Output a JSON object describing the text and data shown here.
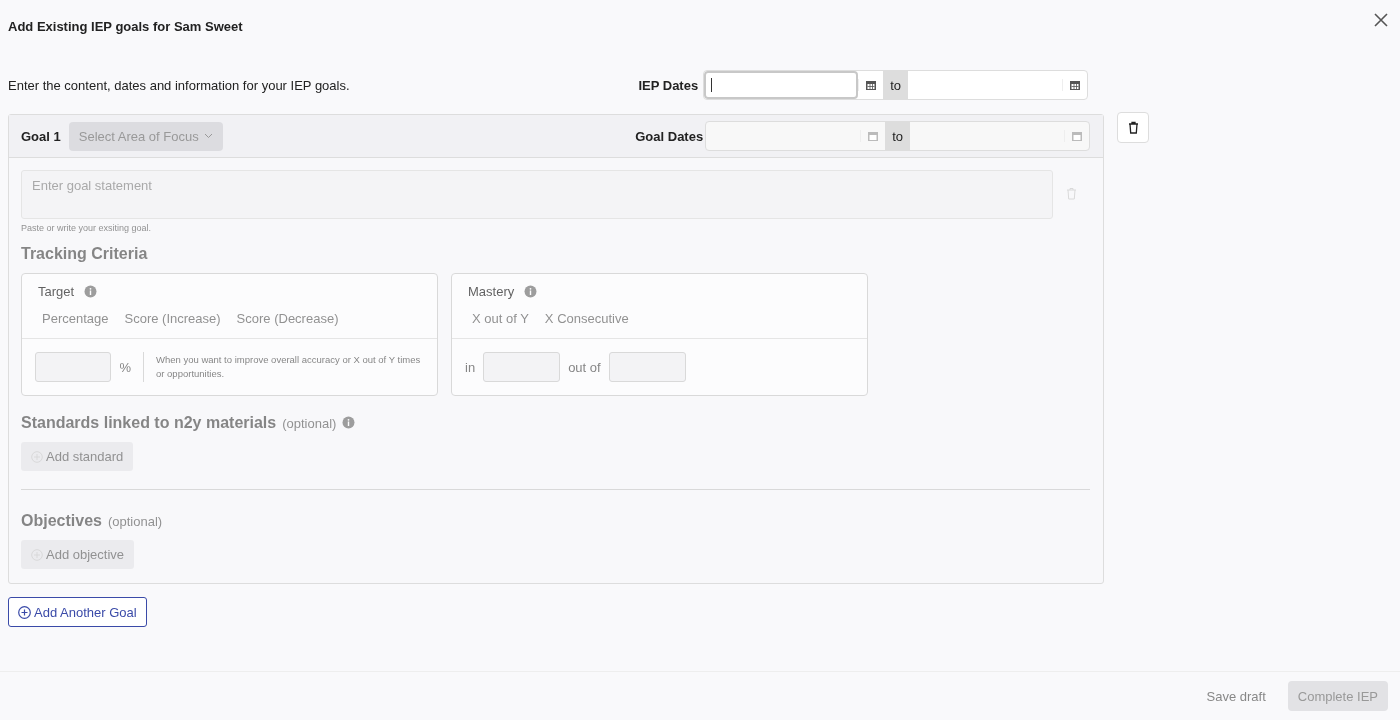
{
  "dialog": {
    "title": "Add Existing IEP goals for Sam Sweet"
  },
  "intro": "Enter the content, dates and information for your IEP goals.",
  "iep_dates": {
    "label": "IEP Dates",
    "separator": "to",
    "focused": true
  },
  "goals": [
    {
      "label": "Goal 1",
      "disabled": true,
      "area_of_focus": {
        "placeholder": "Select Area of Focus"
      },
      "dates": {
        "label": "Goal Dates",
        "separator": "to"
      },
      "statement": {
        "placeholder": "Enter goal statement",
        "hint": "Paste or write your exsiting goal."
      },
      "tracking": {
        "title": "Tracking Criteria",
        "target": {
          "title": "Target",
          "options": [
            {
              "label": "Percentage",
              "selected": false
            },
            {
              "label": "Score (Increase)",
              "selected": false
            },
            {
              "label": "Score (Decrease)",
              "selected": false
            }
          ],
          "unit": "%",
          "description": "When you want to improve overall accuracy or X out of Y times or opportunities."
        },
        "mastery": {
          "title": "Mastery",
          "options": [
            {
              "label": "X out of Y",
              "selected": false
            },
            {
              "label": "X Consecutive",
              "selected": false
            }
          ],
          "in_label": "in",
          "out_of_label": "out of"
        }
      },
      "standards": {
        "title": "Standards linked to n2y materials",
        "optional": "(optional)",
        "button": "Add standard"
      },
      "objectives": {
        "title": "Objectives",
        "optional": "(optional)",
        "button": "Add objective"
      }
    }
  ],
  "add_goal_button": "Add Another Goal",
  "footer": {
    "save": "Save draft",
    "complete": {
      "label": "Complete IEP",
      "disabled": true
    }
  }
}
